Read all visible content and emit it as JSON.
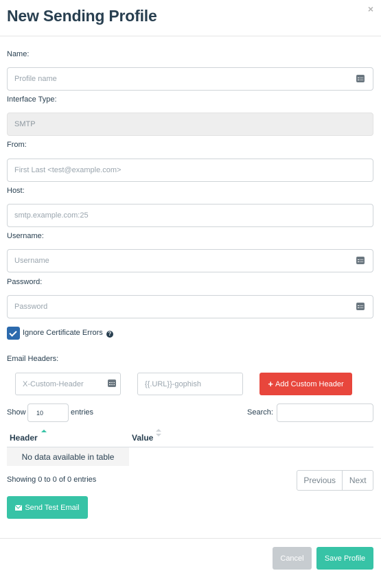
{
  "header": {
    "title": "New Sending Profile",
    "close": "×"
  },
  "fields": {
    "name": {
      "label": "Name:",
      "placeholder": "Profile name"
    },
    "interface_type": {
      "label": "Interface Type:",
      "value": "SMTP"
    },
    "from": {
      "label": "From:",
      "placeholder": "First Last <test@example.com>"
    },
    "host": {
      "label": "Host:",
      "placeholder": "smtp.example.com:25"
    },
    "username": {
      "label": "Username:",
      "placeholder": "Username"
    },
    "password": {
      "label": "Password:",
      "placeholder": "Password"
    }
  },
  "ignore_cert": {
    "label": "Ignore Certificate Errors",
    "checked": true,
    "help_icon": "question-circle-icon"
  },
  "email_headers": {
    "label": "Email Headers:",
    "header_placeholder": "X-Custom-Header",
    "value_placeholder": "{{.URL}}-gophish",
    "add_button": "Add Custom Header"
  },
  "table": {
    "show": "Show",
    "length": "10",
    "entries": "entries",
    "search_label": "Search:",
    "columns": [
      "Header",
      "Value"
    ],
    "empty_message": "No data available in table",
    "info": "Showing 0 to 0 of 0 entries",
    "prev": "Previous",
    "next": "Next"
  },
  "send_test_button": "Send Test Email",
  "footer": {
    "cancel": "Cancel",
    "save": "Save Profile"
  },
  "colors": {
    "primary": "#37c3a6",
    "danger": "#e8463c",
    "checkbox": "#2c6aad",
    "text": "#283f50"
  }
}
